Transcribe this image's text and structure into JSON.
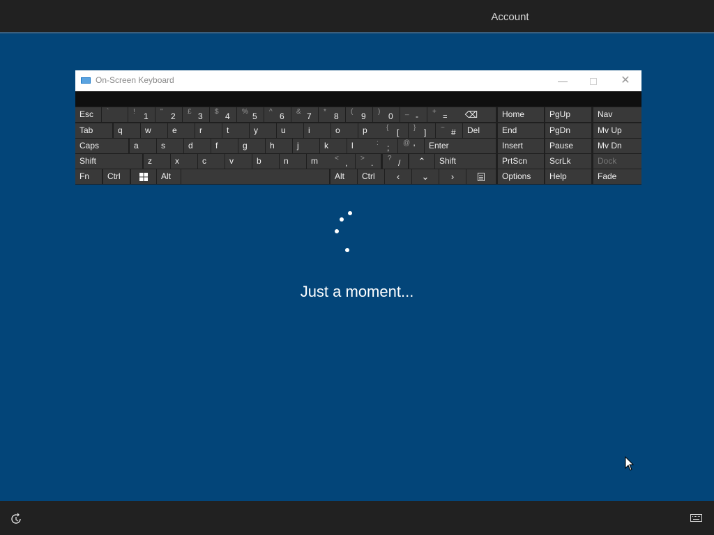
{
  "header": {
    "active_tab": "Account"
  },
  "osk": {
    "title": "On-Screen Keyboard",
    "controls": {
      "minimize": "—",
      "close": "✕"
    },
    "rows": [
      [
        {
          "id": "esc",
          "label": "Esc"
        },
        {
          "id": "backtick",
          "top": "`",
          "bottom": ""
        },
        {
          "id": "1",
          "top": "!",
          "bottom": "1"
        },
        {
          "id": "2",
          "top": "\"",
          "bottom": "2"
        },
        {
          "id": "3",
          "top": "£",
          "bottom": "3"
        },
        {
          "id": "4",
          "top": "$",
          "bottom": "4"
        },
        {
          "id": "5",
          "top": "%",
          "bottom": "5"
        },
        {
          "id": "6",
          "top": "^",
          "bottom": "6"
        },
        {
          "id": "7",
          "top": "&",
          "bottom": "7"
        },
        {
          "id": "8",
          "top": "*",
          "bottom": "8"
        },
        {
          "id": "9",
          "top": "(",
          "bottom": "9"
        },
        {
          "id": "0",
          "top": ")",
          "bottom": "0"
        },
        {
          "id": "minus",
          "top": "_",
          "bottom": "-"
        },
        {
          "id": "equals",
          "top": "+",
          "bottom": "="
        },
        {
          "id": "backspace",
          "label": "⌫"
        }
      ],
      [
        {
          "id": "tab",
          "label": "Tab"
        },
        {
          "id": "q",
          "label": "q"
        },
        {
          "id": "w",
          "label": "w"
        },
        {
          "id": "e",
          "label": "e"
        },
        {
          "id": "r",
          "label": "r"
        },
        {
          "id": "t",
          "label": "t"
        },
        {
          "id": "y",
          "label": "y"
        },
        {
          "id": "u",
          "label": "u"
        },
        {
          "id": "i",
          "label": "i"
        },
        {
          "id": "o",
          "label": "o"
        },
        {
          "id": "p",
          "label": "p"
        },
        {
          "id": "lbracket",
          "top": "{",
          "bottom": "["
        },
        {
          "id": "rbracket",
          "top": "}",
          "bottom": "]"
        },
        {
          "id": "hash",
          "top": "~",
          "bottom": "#"
        },
        {
          "id": "del",
          "label": "Del"
        }
      ],
      [
        {
          "id": "caps",
          "label": "Caps"
        },
        {
          "id": "a",
          "label": "a"
        },
        {
          "id": "s",
          "label": "s"
        },
        {
          "id": "d",
          "label": "d"
        },
        {
          "id": "f",
          "label": "f"
        },
        {
          "id": "g",
          "label": "g"
        },
        {
          "id": "h",
          "label": "h"
        },
        {
          "id": "j",
          "label": "j"
        },
        {
          "id": "k",
          "label": "k"
        },
        {
          "id": "l",
          "label": "l"
        },
        {
          "id": "semicolon",
          "top": ":",
          "bottom": ";"
        },
        {
          "id": "quote",
          "top": "@",
          "bottom": "'"
        },
        {
          "id": "enter",
          "label": "Enter"
        }
      ],
      [
        {
          "id": "lshift",
          "label": "Shift"
        },
        {
          "id": "z",
          "label": "z"
        },
        {
          "id": "x",
          "label": "x"
        },
        {
          "id": "c",
          "label": "c"
        },
        {
          "id": "v",
          "label": "v"
        },
        {
          "id": "b",
          "label": "b"
        },
        {
          "id": "n",
          "label": "n"
        },
        {
          "id": "m",
          "label": "m"
        },
        {
          "id": "comma",
          "top": "<",
          "bottom": ","
        },
        {
          "id": "period",
          "top": ">",
          "bottom": "."
        },
        {
          "id": "slash",
          "top": "?",
          "bottom": "/"
        },
        {
          "id": "up",
          "label": "⌃"
        },
        {
          "id": "rshift",
          "label": "Shift"
        }
      ],
      [
        {
          "id": "fn",
          "label": "Fn"
        },
        {
          "id": "lctrl",
          "label": "Ctrl"
        },
        {
          "id": "win",
          "label": ""
        },
        {
          "id": "lalt",
          "label": "Alt"
        },
        {
          "id": "space",
          "label": ""
        },
        {
          "id": "ralt",
          "label": "Alt"
        },
        {
          "id": "rctrl",
          "label": "Ctrl"
        },
        {
          "id": "left",
          "label": "‹"
        },
        {
          "id": "down",
          "label": "⌄"
        },
        {
          "id": "right",
          "label": "›"
        },
        {
          "id": "menu",
          "label": ""
        }
      ]
    ],
    "nav_cols": [
      [
        "Home",
        "End",
        "Insert",
        "PrtScn",
        "Options"
      ],
      [
        "PgUp",
        "PgDn",
        "Pause",
        "ScrLk",
        "Help"
      ],
      [
        "Nav",
        "Mv Up",
        "Mv Dn",
        "Dock",
        "Fade"
      ]
    ],
    "dim_keys": [
      "Dock"
    ]
  },
  "status": {
    "message": "Just a moment..."
  },
  "footer": {
    "accessibility_icon": "ease-of-access-icon",
    "keyboard_icon": "keyboard-icon"
  }
}
